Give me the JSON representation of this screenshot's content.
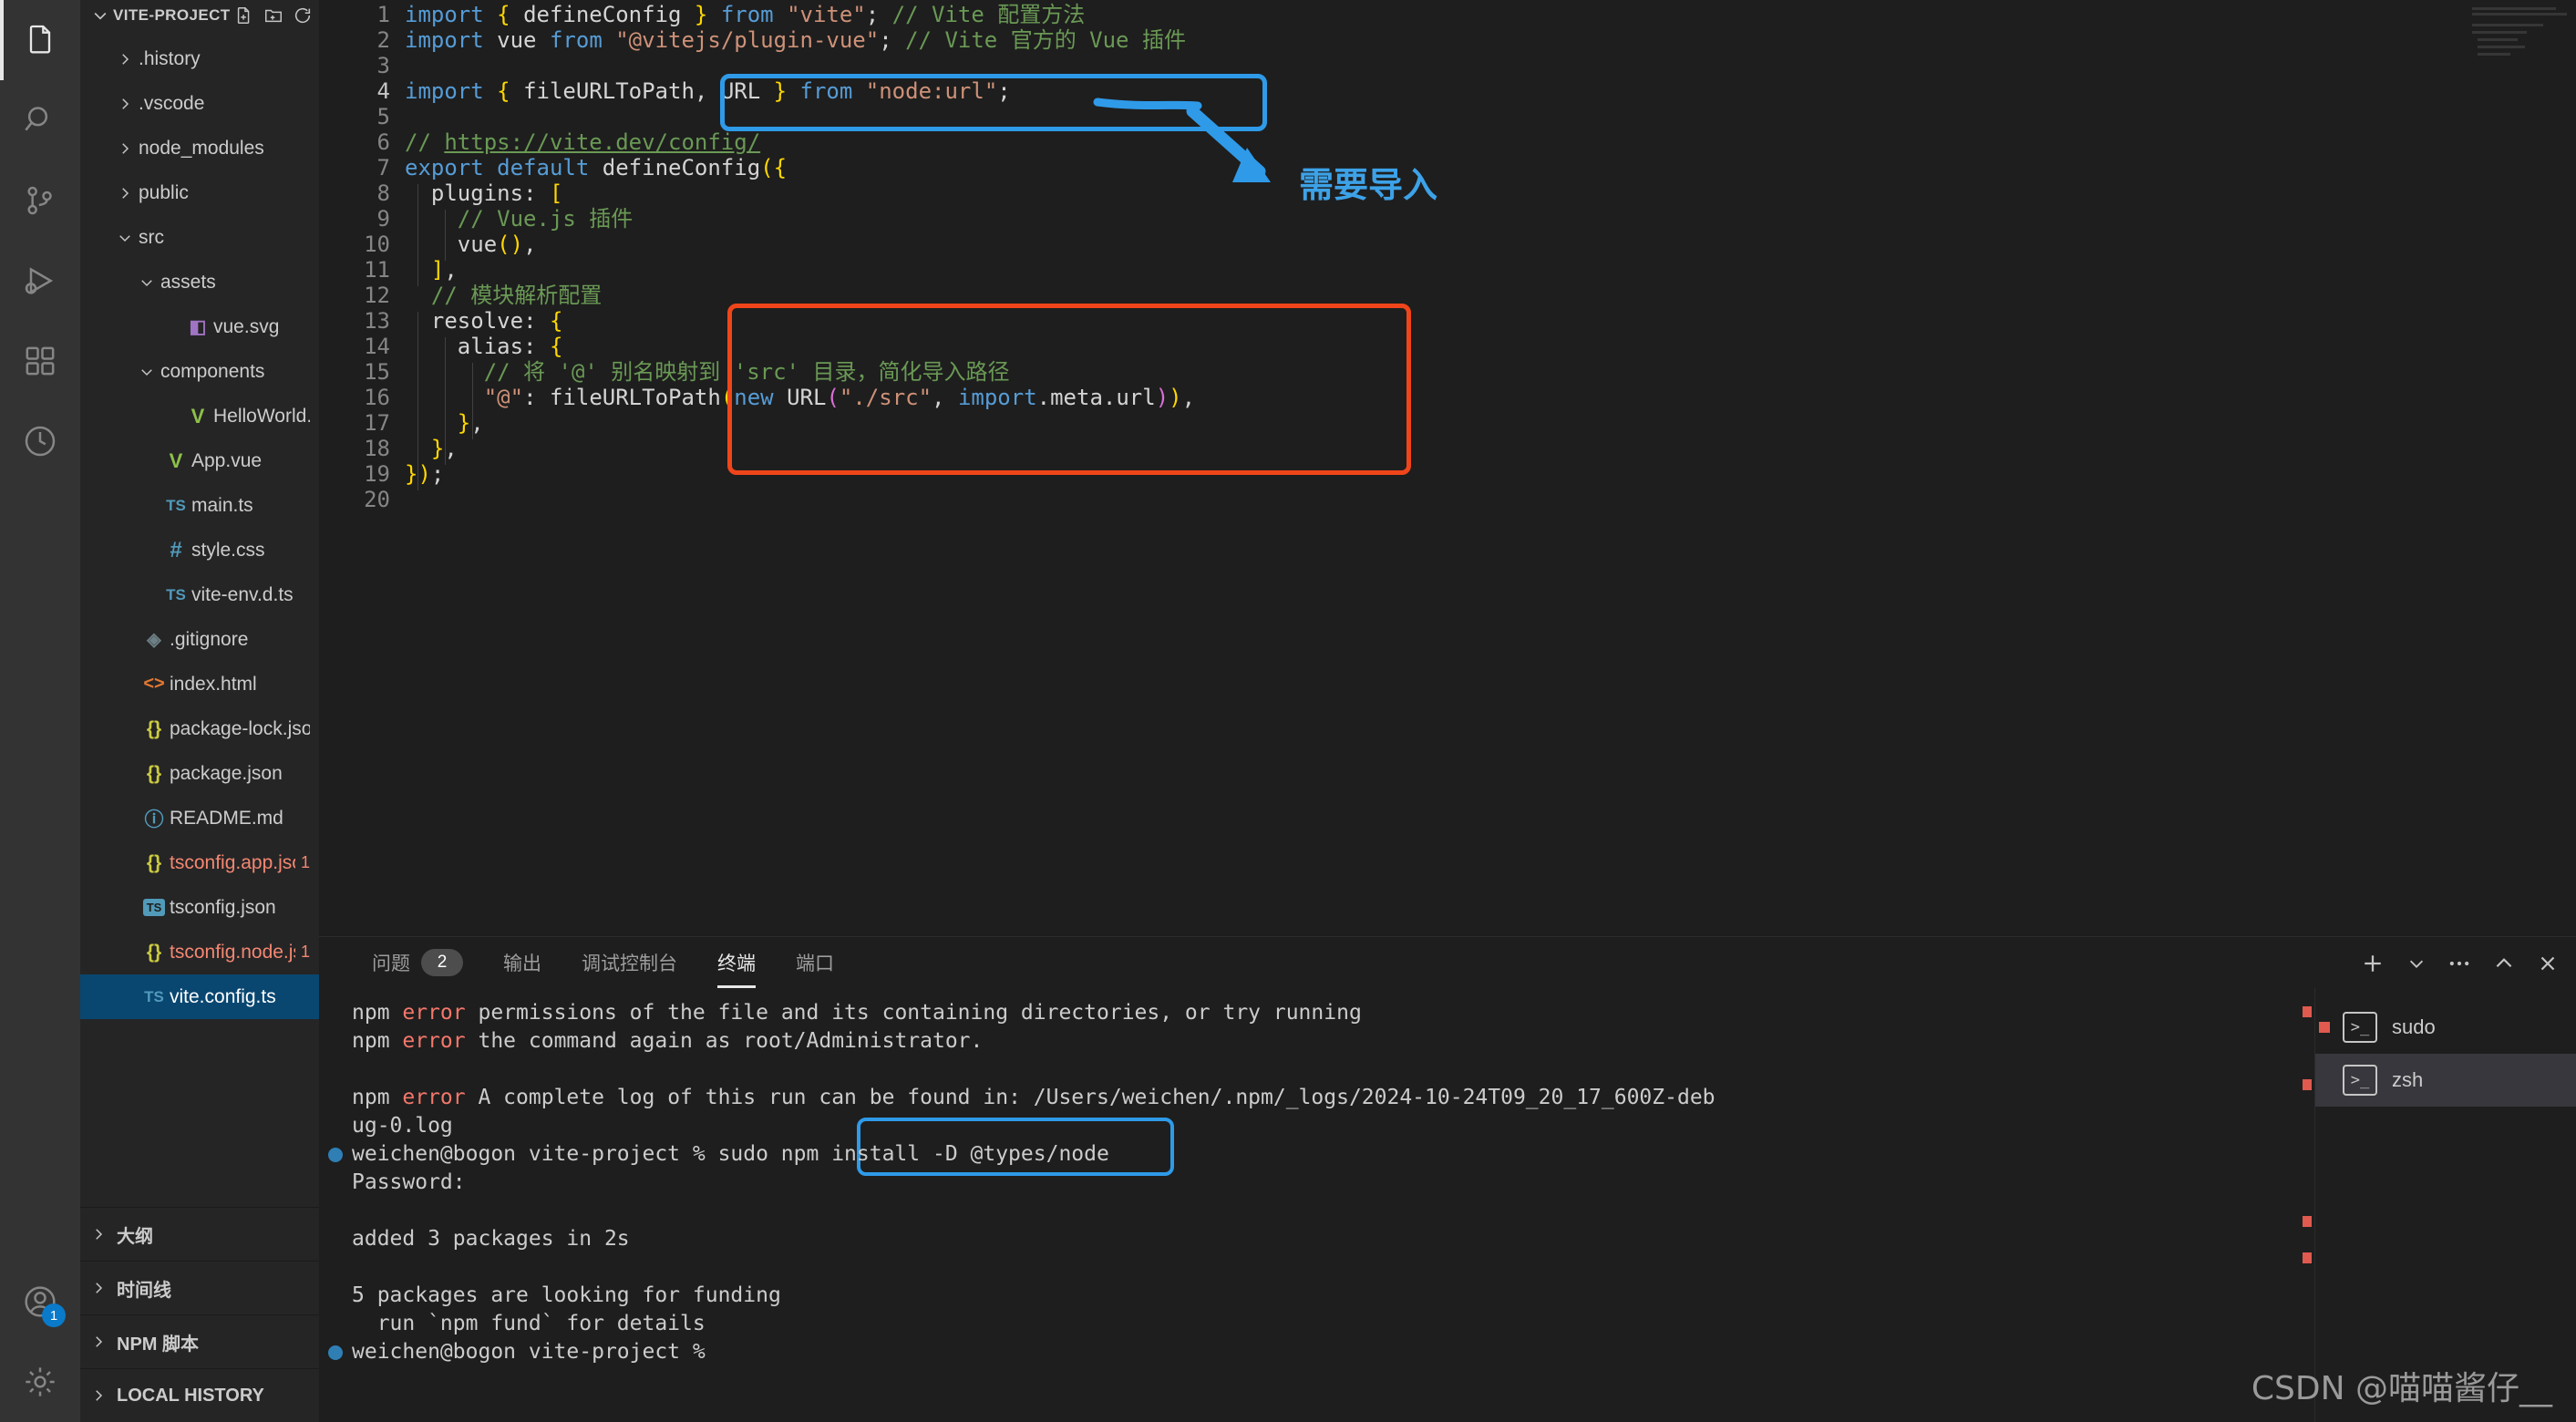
{
  "activity_bar": {
    "items": [
      {
        "name": "explorer",
        "icon": "files-icon",
        "active": true
      },
      {
        "name": "search",
        "icon": "search-icon",
        "active": false
      },
      {
        "name": "source-control",
        "icon": "source-control-icon",
        "active": false
      },
      {
        "name": "run-and-debug",
        "icon": "run-debug-icon",
        "active": false
      },
      {
        "name": "extensions",
        "icon": "extensions-icon",
        "active": false
      },
      {
        "name": "testing",
        "icon": "beaker-icon",
        "active": false
      }
    ],
    "bottom_items": [
      {
        "name": "accounts",
        "icon": "account-icon",
        "badge": "1"
      },
      {
        "name": "manage",
        "icon": "gear-icon",
        "badge": ""
      }
    ]
  },
  "sidebar": {
    "title": "VITE-PROJECT",
    "header_actions": [
      {
        "name": "new-file",
        "icon": "new-file-icon"
      },
      {
        "name": "new-folder",
        "icon": "new-folder-icon"
      },
      {
        "name": "refresh-explorer",
        "icon": "refresh-icon"
      },
      {
        "name": "collapse-folders",
        "icon": "collapse-all-icon"
      }
    ],
    "tree": [
      {
        "label": ".history",
        "indent": 1,
        "type": "folder",
        "state": "collapsed",
        "icon": "chevron-right-icon",
        "error": ""
      },
      {
        "label": ".vscode",
        "indent": 1,
        "type": "folder",
        "state": "collapsed",
        "icon": "chevron-right-icon",
        "error": ""
      },
      {
        "label": "node_modules",
        "indent": 1,
        "type": "folder",
        "state": "collapsed",
        "icon": "chevron-right-icon",
        "error": ""
      },
      {
        "label": "public",
        "indent": 1,
        "type": "folder",
        "state": "collapsed",
        "icon": "chevron-right-icon",
        "error": ""
      },
      {
        "label": "src",
        "indent": 1,
        "type": "folder",
        "state": "expanded",
        "icon": "chevron-down-icon",
        "error": ""
      },
      {
        "label": "assets",
        "indent": 2,
        "type": "folder",
        "state": "expanded",
        "icon": "chevron-down-icon",
        "error": ""
      },
      {
        "label": "vue.svg",
        "indent": 3,
        "type": "file",
        "state": "",
        "icon": "svg-icon",
        "error": ""
      },
      {
        "label": "components",
        "indent": 2,
        "type": "folder",
        "state": "expanded",
        "icon": "chevron-down-icon",
        "error": ""
      },
      {
        "label": "HelloWorld.vue",
        "indent": 3,
        "type": "file",
        "state": "",
        "icon": "vue-icon",
        "error": ""
      },
      {
        "label": "App.vue",
        "indent": 2,
        "type": "file",
        "state": "",
        "icon": "vue-icon",
        "error": ""
      },
      {
        "label": "main.ts",
        "indent": 2,
        "type": "file",
        "state": "",
        "icon": "ts-icon",
        "error": ""
      },
      {
        "label": "style.css",
        "indent": 2,
        "type": "file",
        "state": "",
        "icon": "css-icon",
        "error": ""
      },
      {
        "label": "vite-env.d.ts",
        "indent": 2,
        "type": "file",
        "state": "",
        "icon": "ts-icon",
        "error": ""
      },
      {
        "label": ".gitignore",
        "indent": 1,
        "type": "file",
        "state": "",
        "icon": "git-icon",
        "error": ""
      },
      {
        "label": "index.html",
        "indent": 1,
        "type": "file",
        "state": "",
        "icon": "html-icon",
        "error": ""
      },
      {
        "label": "package-lock.json",
        "indent": 1,
        "type": "file",
        "state": "",
        "icon": "json-icon",
        "error": ""
      },
      {
        "label": "package.json",
        "indent": 1,
        "type": "file",
        "state": "",
        "icon": "json-icon",
        "error": ""
      },
      {
        "label": "README.md",
        "indent": 1,
        "type": "file",
        "state": "",
        "icon": "info-icon",
        "error": ""
      },
      {
        "label": "tsconfig.app.json",
        "indent": 1,
        "type": "file",
        "state": "",
        "icon": "json-icon",
        "error": "1"
      },
      {
        "label": "tsconfig.json",
        "indent": 1,
        "type": "file",
        "state": "",
        "icon": "tsconfig-icon",
        "error": ""
      },
      {
        "label": "tsconfig.node.json",
        "indent": 1,
        "type": "file",
        "state": "",
        "icon": "json-icon",
        "error": "1"
      },
      {
        "label": "vite.config.ts",
        "indent": 1,
        "type": "file",
        "state": "",
        "icon": "ts-icon",
        "error": "",
        "selected": true
      }
    ],
    "sections": [
      {
        "label": "大纲",
        "icon": "chevron-right-icon"
      },
      {
        "label": "时间线",
        "icon": "chevron-right-icon"
      },
      {
        "label": "NPM 脚本",
        "icon": "chevron-right-icon"
      },
      {
        "label": "LOCAL HISTORY",
        "icon": "chevron-right-icon"
      }
    ]
  },
  "editor": {
    "line_numbers": [
      "1",
      "2",
      "3",
      "4",
      "5",
      "6",
      "7",
      "8",
      "9",
      "10",
      "11",
      "12",
      "13",
      "14",
      "15",
      "16",
      "17",
      "18",
      "19",
      "20"
    ],
    "code": [
      "import { defineConfig } from \"vite\"; // Vite 配置方法",
      "import vue from \"@vitejs/plugin-vue\"; // Vite 官方的 Vue 插件",
      "",
      "import { fileURLToPath, URL } from \"node:url\";",
      "",
      "// https://vite.dev/config/",
      "export default defineConfig({",
      "  plugins: [",
      "    // Vue.js 插件",
      "    vue(),",
      "  ],",
      "  // 模块解析配置",
      "  resolve: {",
      "    alias: {",
      "      // 将 '@' 别名映射到 'src' 目录，简化导入路径",
      "      \"@\": fileURLToPath(new URL(\"./src\", import.meta.url)),",
      "    },",
      "  },",
      "});",
      ""
    ],
    "annotations": [
      {
        "name": "import-highlight-box",
        "color": "#2f9ae8",
        "note": "blue box around line 4 import statement"
      },
      {
        "name": "resolve-highlight-box",
        "color": "#f0451a",
        "note": "red box around resolve/alias block lines 13-18"
      },
      {
        "name": "arrow-annotation",
        "color": "#2f9ae8",
        "text": "需要导入"
      }
    ],
    "annotation_text": "需要导入"
  },
  "panel": {
    "tabs": [
      {
        "label": "问题",
        "badge": "2",
        "active": false
      },
      {
        "label": "输出",
        "badge": "",
        "active": false
      },
      {
        "label": "调试控制台",
        "badge": "",
        "active": false
      },
      {
        "label": "终端",
        "badge": "",
        "active": true
      },
      {
        "label": "端口",
        "badge": "",
        "active": false
      }
    ],
    "actions": [
      {
        "name": "new-terminal-button",
        "icon": "plus-icon"
      },
      {
        "name": "terminal-profile-dropdown",
        "icon": "chevron-down-icon"
      },
      {
        "name": "panel-more-actions",
        "icon": "ellipsis-icon"
      },
      {
        "name": "maximize-panel-button",
        "icon": "chevron-up-icon"
      },
      {
        "name": "close-panel-button",
        "icon": "close-icon"
      }
    ],
    "terminal_lines": [
      {
        "prefix": "npm",
        "err": "error",
        "text": " permissions of the file and its containing directories, or try running",
        "marker": false
      },
      {
        "prefix": "npm",
        "err": "error",
        "text": " the command again as root/Administrator.",
        "marker": false
      },
      {
        "prefix": "",
        "err": "",
        "text": "",
        "marker": false
      },
      {
        "prefix": "npm",
        "err": "error",
        "text": " A complete log of this run can be found in: /Users/weichen/.npm/_logs/2024-10-24T09_20_17_600Z-deb",
        "marker": false
      },
      {
        "prefix": "",
        "err": "",
        "text": "ug-0.log",
        "marker": false
      },
      {
        "prefix": "",
        "err": "",
        "text": "weichen@bogon vite-project % sudo npm install -D @types/node",
        "marker": true
      },
      {
        "prefix": "",
        "err": "",
        "text": "Password:",
        "marker": false
      },
      {
        "prefix": "",
        "err": "",
        "text": "",
        "marker": false
      },
      {
        "prefix": "",
        "err": "",
        "text": "added 3 packages in 2s",
        "marker": false
      },
      {
        "prefix": "",
        "err": "",
        "text": "",
        "marker": false
      },
      {
        "prefix": "",
        "err": "",
        "text": "5 packages are looking for funding",
        "marker": false
      },
      {
        "prefix": "",
        "err": "",
        "text": "  run `npm fund` for details",
        "marker": false
      },
      {
        "prefix": "",
        "err": "",
        "text": "weichen@bogon vite-project % ",
        "marker": true
      }
    ],
    "command_highlight": "% sudo npm install -D @types/node",
    "terminal_list": [
      {
        "label": "sudo",
        "icon": "terminal-icon",
        "active": false,
        "error_mark": true
      },
      {
        "label": "zsh",
        "icon": "terminal-icon",
        "active": true,
        "error_mark": false
      }
    ]
  },
  "watermark": "CSDN @喵喵酱仔__",
  "colors": {
    "accent_blue": "#2f9ae8",
    "accent_red": "#f0451a",
    "selection": "#094771",
    "error": "#f48771"
  }
}
